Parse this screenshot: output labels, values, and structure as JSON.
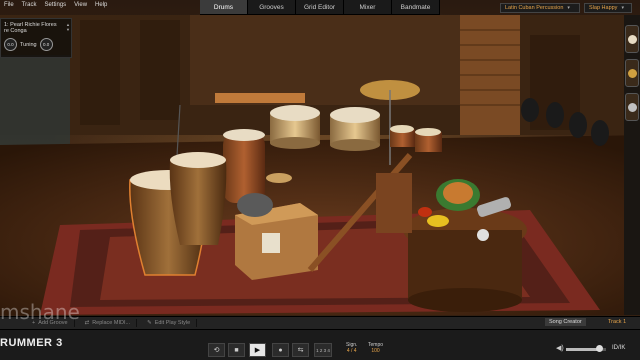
{
  "menu": [
    "File",
    "Track",
    "Settings",
    "View",
    "Help"
  ],
  "tabs": [
    {
      "label": "Drums",
      "active": true
    },
    {
      "label": "Grooves",
      "active": false
    },
    {
      "label": "Grid Editor",
      "active": false
    },
    {
      "label": "Mixer",
      "active": false
    },
    {
      "label": "Bandmate",
      "active": false
    }
  ],
  "presets": {
    "kit": "Latin Cuban Percussion",
    "style": "Slap Happy"
  },
  "instrument": {
    "line1": "1: Pearl Richie Flores",
    "line2": "re Conga",
    "knob1_value": "0.0",
    "tuning_label": "Tuning",
    "knob2_value": "0.0"
  },
  "lower_toolbar": {
    "add_groove": "Add Groove",
    "replace_midi": "Replace MIDI...",
    "edit_play_style": "Edit Play Style",
    "song_creator": "Song Creator",
    "track": "Track 1"
  },
  "transport": {
    "logo": "RUMMER",
    "logo_num": "3",
    "watermark": "mshane",
    "meter_label": "1 2 3 4",
    "sign_label": "Sign.",
    "sign_value": "4 / 4",
    "tempo_label": "Tempo",
    "tempo_value": "100",
    "volume_level": 0.85,
    "corner_logo": "ID/IK"
  },
  "colors": {
    "accent": "#e8a54a",
    "bar": "#1b1b1b"
  },
  "icons": [
    "loop-icon",
    "stop-icon",
    "play-icon",
    "record-icon",
    "follow-icon",
    "speaker-icon",
    "chevron-down-icon",
    "arrow-updown-icon"
  ]
}
